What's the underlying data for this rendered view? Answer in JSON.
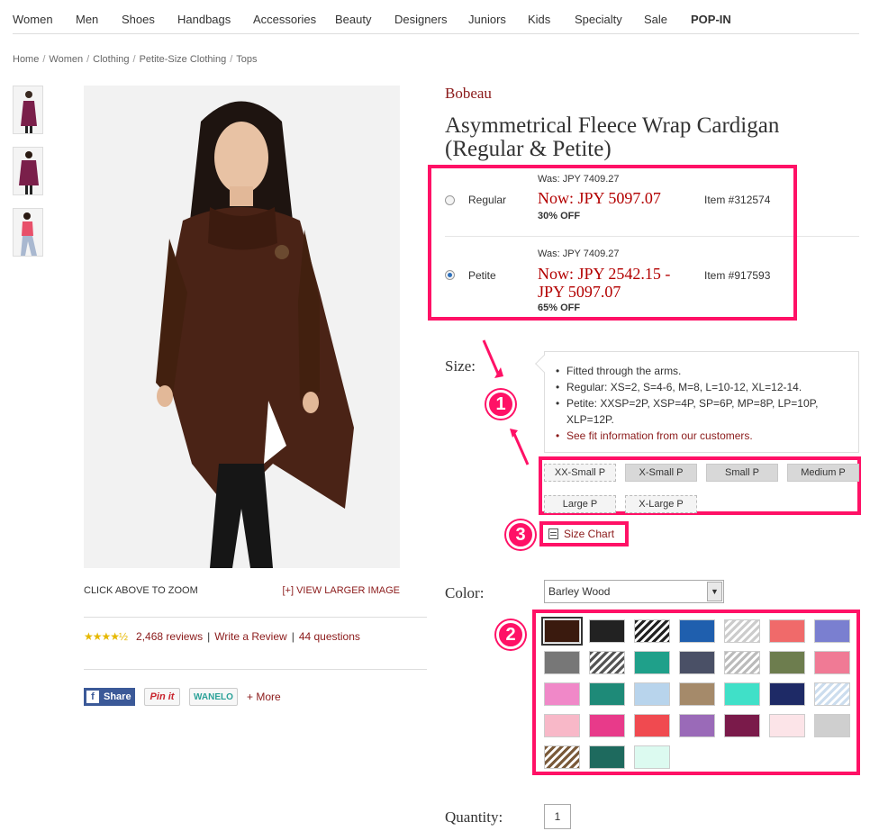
{
  "nav": [
    "Women",
    "Men",
    "Shoes",
    "Handbags",
    "Accessories",
    "Beauty",
    "Designers",
    "Juniors",
    "Kids",
    "Specialty",
    "Sale",
    "POP-IN"
  ],
  "breadcrumb": [
    "Home",
    "Women",
    "Clothing",
    "Petite-Size Clothing",
    "Tops"
  ],
  "image": {
    "zoom_hint": "CLICK ABOVE TO ZOOM",
    "larger_link": "[+] VIEW LARGER IMAGE"
  },
  "reviews": {
    "stars": "★★★★½",
    "rating": 4.5,
    "count_label": "2,468 reviews",
    "write_label": "Write a Review",
    "questions_label": "44 questions"
  },
  "share": {
    "facebook": "Share",
    "pinterest": "Pin it",
    "wanelo": "WANELO",
    "more": "+ More"
  },
  "product": {
    "brand": "Bobeau",
    "title": "Asymmetrical Fleece Wrap Cardigan (Regular & Petite)"
  },
  "prices": [
    {
      "label": "Regular",
      "was": "Was: JPY 7409.27",
      "now": "Now: JPY 5097.07",
      "off": "30% OFF",
      "item": "Item #312574",
      "selected": false
    },
    {
      "label": "Petite",
      "was": "Was: JPY 7409.27",
      "now": "Now: JPY 2542.15 - JPY 5097.07",
      "off": "65% OFF",
      "item": "Item #917593",
      "selected": true
    }
  ],
  "size": {
    "label": "Size:",
    "fit_notes": [
      "Fitted through the arms.",
      "Regular: XS=2, S=4-6, M=8, L=10-12, XL=12-14.",
      "Petite: XXSP=2P, XSP=4P, SP=6P, MP=8P, LP=10P, XLP=12P."
    ],
    "fit_link": "See fit information from our customers.",
    "options": [
      "XX-Small P",
      "X-Small P",
      "Small P",
      "Medium P",
      "Large P",
      "X-Large P"
    ],
    "chart_label": "Size Chart"
  },
  "color": {
    "label": "Color:",
    "selected": "Barley Wood",
    "swatches": [
      "#3a1a0e",
      "#222222",
      "stripe:#222",
      "#1f5fae",
      "stripe:#ccc",
      "#f06a6a",
      "#7a7fd0",
      "#777777",
      "stripe:#555",
      "#1fa08a",
      "#4a5066",
      "stripe:#bbb",
      "#6d7d4e",
      "#f07a95",
      "#f088c8",
      "#1e8a78",
      "#b8d4ec",
      "#a58a6a",
      "#40e0c8",
      "#1e2a66",
      "stripe:#cde",
      "#f8b8c8",
      "#e83a8a",
      "#f04a50",
      "#9a6ab8",
      "#7a1a4a",
      "#fce4e8",
      "#cfcfcf",
      "stripe:#7a5a3a",
      "#1e6a5e",
      "#dcfaf0"
    ]
  },
  "quantity": {
    "label": "Quantity:",
    "value": "1"
  },
  "annotations": [
    "1",
    "2",
    "3"
  ]
}
